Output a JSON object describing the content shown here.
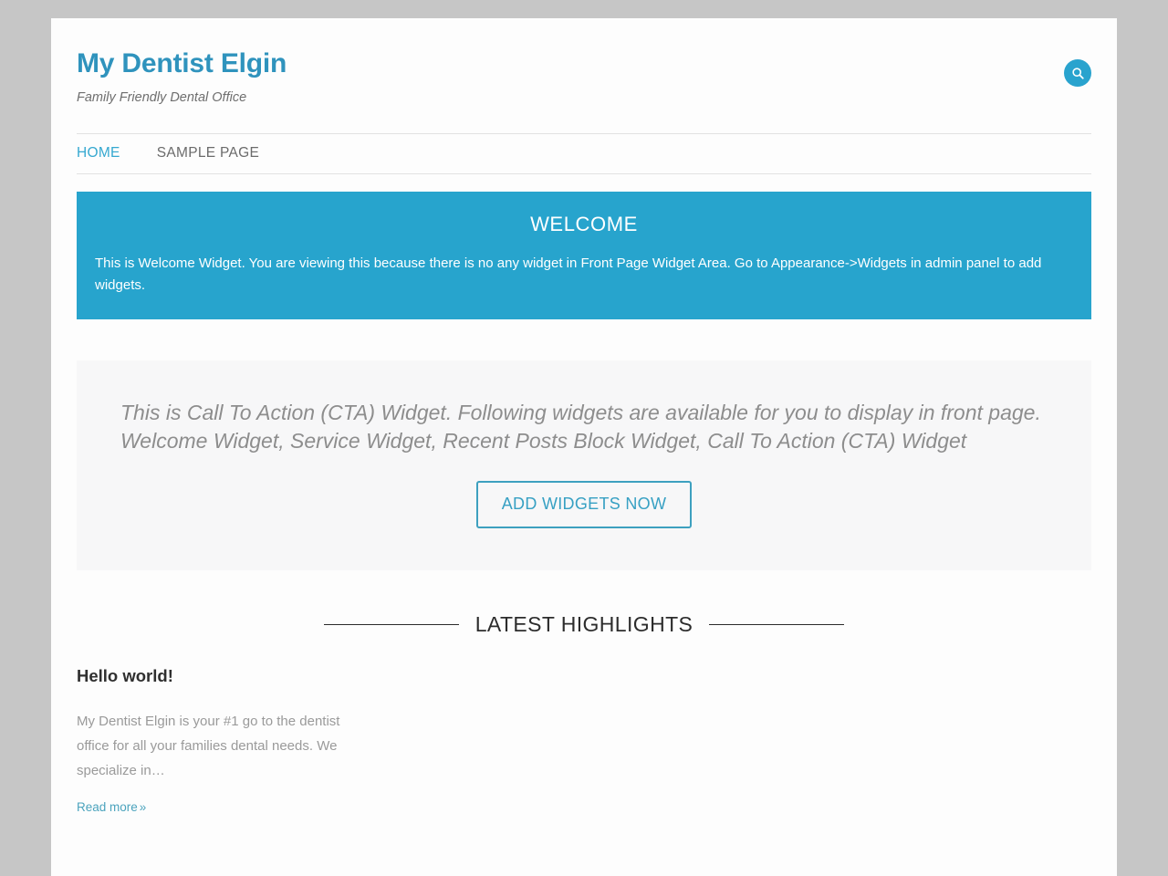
{
  "site": {
    "title": "My Dentist Elgin",
    "description": "Family Friendly Dental Office",
    "accent_color": "#29a3ce",
    "banner_color": "#27a4cd",
    "page_background": "#c6c6c6",
    "container_background": "#fdfdfd"
  },
  "header": {
    "search_icon": "search-icon",
    "search_label": "Search"
  },
  "nav": {
    "items": [
      {
        "label": "HOME",
        "active": true
      },
      {
        "label": "SAMPLE PAGE",
        "active": false
      }
    ]
  },
  "welcome": {
    "title": "WELCOME",
    "text": "This is Welcome Widget. You are viewing this because there is no any widget in Front Page Widget Area. Go to Appearance->Widgets in admin panel to add widgets."
  },
  "cta": {
    "text": "This is Call To Action (CTA) Widget. Following widgets are available for you to display in front page. Welcome Widget, Service Widget, Recent Posts Block Widget, Call To Action (CTA) Widget",
    "button_label": "ADD WIDGETS NOW",
    "button_color": "#37a0c3",
    "background": "#f7f7f8"
  },
  "highlights": {
    "title": "LATEST HIGHLIGHTS",
    "posts": [
      {
        "title": "Hello world!",
        "excerpt": "My Dentist Elgin is your #1 go to the dentist office for all your families dental needs. We specialize in…",
        "read_more": "Read more",
        "read_more_chevron": "»"
      }
    ]
  }
}
